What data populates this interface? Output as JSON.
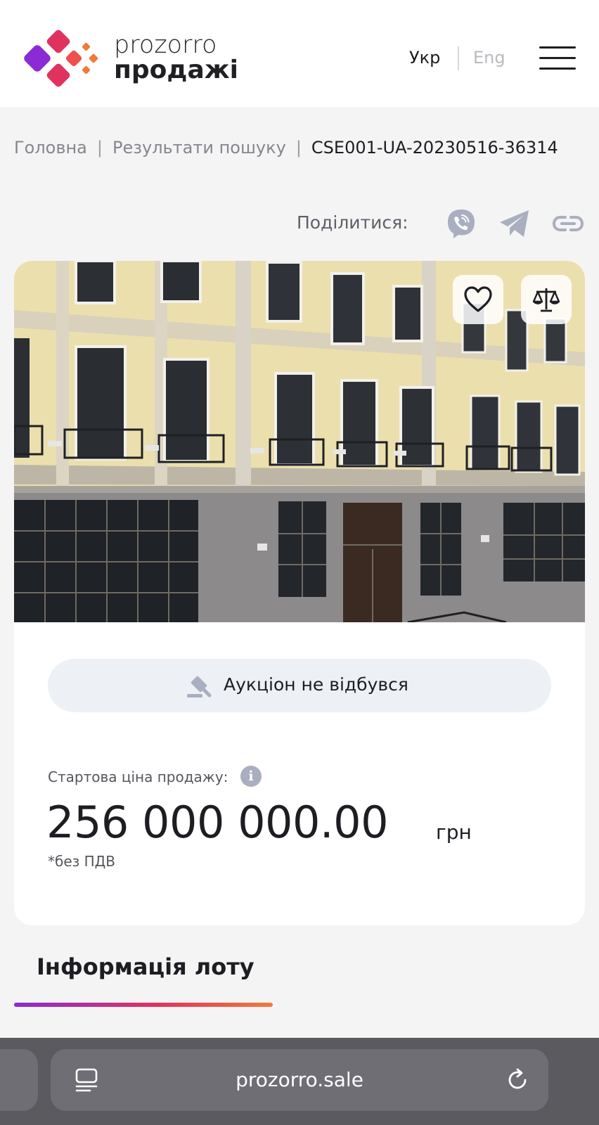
{
  "header": {
    "logo_line1": "prozorro",
    "logo_line2": "продажі",
    "lang_active": "Укр",
    "lang_inactive": "Eng"
  },
  "breadcrumb": {
    "home": "Головна",
    "search": "Результати пошуку",
    "current": "CSE001-UA-20230516-36314",
    "separator": "|"
  },
  "share": {
    "label": "Поділитися:",
    "icons": [
      "viber-icon",
      "telegram-icon",
      "link-icon"
    ]
  },
  "lot": {
    "status": "Аукціон не відбувся",
    "price_label": "Стартова ціна продажу:",
    "price_value": "256 000 000.00",
    "currency": "грн",
    "vat_note": "*без ПДВ",
    "section_title": "Інформація лоту"
  },
  "browser": {
    "url": "prozorro.sale"
  },
  "colors": {
    "accent_purple": "#8b2bd4",
    "accent_pink": "#e0325f",
    "accent_orange": "#f07a3a",
    "icon_gray": "#a9aec0"
  }
}
